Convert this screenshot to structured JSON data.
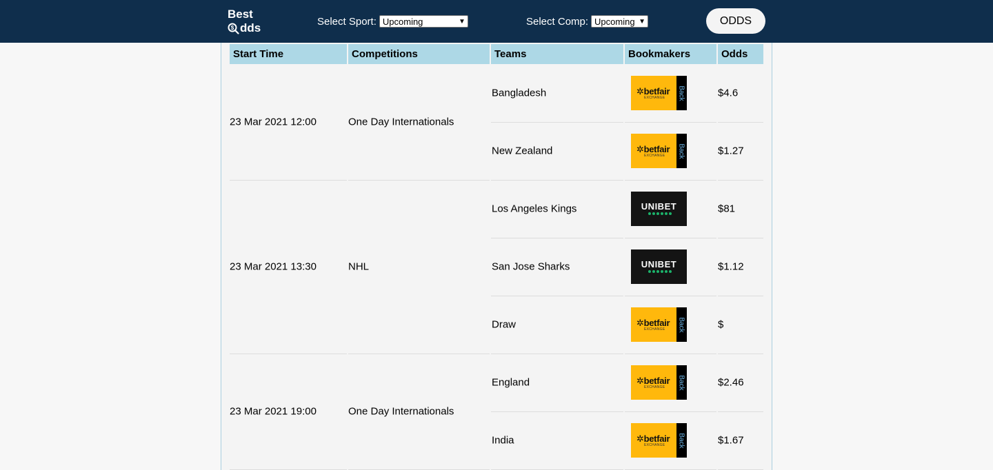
{
  "header": {
    "logo_line1": "Best",
    "logo_line2": "dds",
    "sport_label": "Select Sport:",
    "sport_value": "Upcoming",
    "comp_label": "Select Comp:",
    "comp_value": "Upcoming",
    "odds_button": "ODDS"
  },
  "colors": {
    "header_bg": "#0f2e4c",
    "table_header_bg": "#add8e6",
    "betfair_yellow": "#ffb80c",
    "unibet_green": "#1cb36b"
  },
  "table": {
    "columns": [
      "Start Time",
      "Competitions",
      "Teams",
      "Bookmakers",
      "Odds"
    ],
    "events": [
      {
        "start": "23 Mar 2021 12:00",
        "competition": "One Day Internationals",
        "rows": [
          {
            "team": "Bangladesh",
            "bookmaker": "betfair",
            "odds": "$4.6"
          },
          {
            "team": "New Zealand",
            "bookmaker": "betfair",
            "odds": "$1.27"
          }
        ]
      },
      {
        "start": "23 Mar 2021 13:30",
        "competition": "NHL",
        "rows": [
          {
            "team": "Los Angeles Kings",
            "bookmaker": "unibet",
            "odds": "$81"
          },
          {
            "team": "San Jose Sharks",
            "bookmaker": "unibet",
            "odds": "$1.12"
          },
          {
            "team": "Draw",
            "bookmaker": "betfair",
            "odds": "$"
          }
        ]
      },
      {
        "start": "23 Mar 2021 19:00",
        "competition": "One Day Internationals",
        "rows": [
          {
            "team": "England",
            "bookmaker": "betfair",
            "odds": "$2.46"
          },
          {
            "team": "India",
            "bookmaker": "betfair",
            "odds": "$1.67"
          }
        ]
      }
    ]
  },
  "bookmaker_logos": {
    "betfair": {
      "wordmark": "betfair",
      "subtext": "EXCHANGE",
      "tag": "Back"
    },
    "unibet": {
      "wordmark": "UNIBET"
    }
  }
}
